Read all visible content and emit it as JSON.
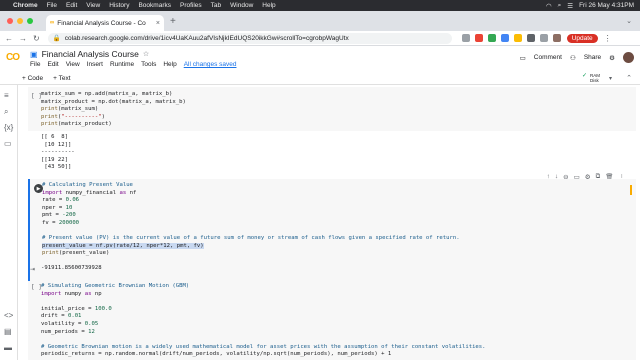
{
  "menubar": {
    "app": "Chrome",
    "items": [
      "File",
      "Edit",
      "View",
      "History",
      "Bookmarks",
      "Profiles",
      "Tab",
      "Window",
      "Help"
    ],
    "datetime": "Fri 26 May 4:31PM"
  },
  "browser": {
    "tab_title": "Financial Analysis Course - Co",
    "url": "colab.research.google.com/drive/1icv4UaKAuu2afVIsNjkIEdUQS20ikkGw#scrollTo=cgrobpWagUtx",
    "update_label": "Update",
    "colors": {
      "update": "#d93025",
      "accent": "#1a73e8"
    }
  },
  "colab": {
    "logo": "CO",
    "title": "Financial Analysis Course",
    "menus": [
      "File",
      "Edit",
      "View",
      "Insert",
      "Runtime",
      "Tools",
      "Help"
    ],
    "saved_status": "All changes saved",
    "comment_label": "Comment",
    "share_label": "Share",
    "add_code": "+ Code",
    "add_text": "+ Text",
    "ram": "RAM",
    "disk": "Disk"
  },
  "cells": {
    "c1": {
      "bracket": "[ ]",
      "l1a": "matrix_sum = np.add(matrix_a, matrix_b)",
      "l2a": "matrix_product = np.dot(matrix_a, matrix_b)",
      "l3a": "print",
      "l3b": "(matrix_sum)",
      "l4a": "print",
      "l4b": "(",
      "l4c": "\"----------\"",
      "l4d": ")",
      "l5a": "print",
      "l5b": "(matrix_product)",
      "out": [
        "[[ 6  8]",
        " [10 12]]",
        "----------",
        "[[19 22]",
        " [43 50]]"
      ]
    },
    "c2": {
      "comment1": "# Calculating Present Value",
      "imp_kw": "import",
      "imp_mod": " numpy_financial ",
      "imp_as": "as",
      "imp_alias": " nf",
      "rate_a": "rate = ",
      "rate_v": "0.06",
      "nper_a": "nper = ",
      "nper_v": "10",
      "pmt_a": "pmt = ",
      "pmt_v": "-200",
      "fv_a": "fv = ",
      "fv_v": "200000",
      "comment2": "# Present value (PV) is the current value of a future sum of money or stream of cash flows given a specified rate of return.",
      "pv_a": "present_value",
      "pv_b": " = nf.pv(rate/12, nper*12, pmt, fv)",
      "pr_a": "print",
      "pr_b": "(present_value)",
      "output": "-91911.85600739928"
    },
    "c3": {
      "bracket": "[ ]",
      "comment1": "# Simulating Geometric Brownian Motion (GBM)",
      "imp_kw": "import",
      "imp_mod": " numpy ",
      "imp_as": "as",
      "imp_alias": " np",
      "ip_a": "initial_price = ",
      "ip_v": "100.0",
      "dr_a": "drift = ",
      "dr_v": "0.01",
      "vo_a": "volatility = ",
      "vo_v": "0.05",
      "np_a": "num_periods = ",
      "np_v": "12",
      "comment2": "# Geometric Brownian motion is a widely used mathematical model for asset prices with the assumption of their constant volatilities.",
      "last": "periodic_returns = np.random.normal(drift/num_periods, volatility/np.sqrt(num_periods), num_periods) + 1"
    }
  }
}
